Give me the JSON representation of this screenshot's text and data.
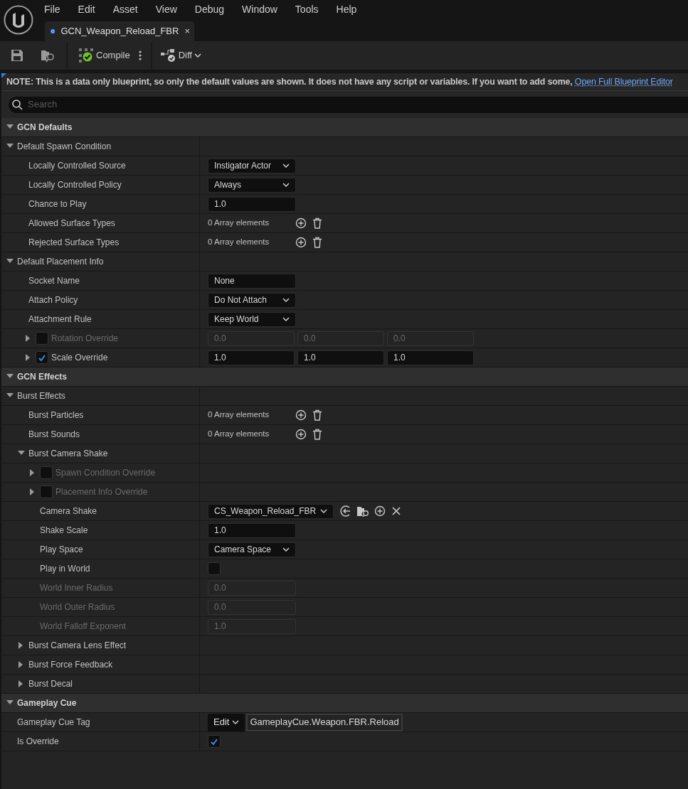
{
  "menu": [
    "File",
    "Edit",
    "Asset",
    "View",
    "Debug",
    "Window",
    "Tools",
    "Help"
  ],
  "tab": {
    "title": "GCN_Weapon_Reload_FBR",
    "close": "×"
  },
  "toolbar": {
    "compile": "Compile",
    "diff": "Diff"
  },
  "note": {
    "text": "NOTE: This is a data only blueprint, so only the default values are shown.  It does not have any script or variables.  If you want to add some,",
    "link": "Open Full Blueprint Editor"
  },
  "search": {
    "placeholder": "Search"
  },
  "categories": [
    {
      "label": "GCN Defaults",
      "expanded": true,
      "children": [
        {
          "kind": "group",
          "label": "Default Spawn Condition",
          "expanded": true,
          "children": [
            {
              "kind": "dropdown",
              "label": "Locally Controlled Source",
              "value": "Instigator Actor"
            },
            {
              "kind": "dropdown",
              "label": "Locally Controlled Policy",
              "value": "Always"
            },
            {
              "kind": "number",
              "label": "Chance to Play",
              "value": "1.0",
              "disabled": false
            },
            {
              "kind": "array",
              "label": "Allowed Surface Types",
              "value": "0 Array elements"
            },
            {
              "kind": "array",
              "label": "Rejected Surface Types",
              "value": "0 Array elements"
            }
          ]
        },
        {
          "kind": "group",
          "label": "Default Placement Info",
          "expanded": true,
          "children": [
            {
              "kind": "text",
              "label": "Socket Name",
              "value": "None"
            },
            {
              "kind": "dropdown",
              "label": "Attach Policy",
              "value": "Do Not Attach"
            },
            {
              "kind": "dropdown",
              "label": "Attachment Rule",
              "value": "Keep World"
            },
            {
              "kind": "vector",
              "label": "Rotation Override",
              "checked": false,
              "expanded": false,
              "values": [
                "0.0",
                "0.0",
                "0.0"
              ]
            },
            {
              "kind": "vector",
              "label": "Scale Override",
              "checked": true,
              "expanded": false,
              "values": [
                "1.0",
                "1.0",
                "1.0"
              ]
            }
          ]
        }
      ]
    },
    {
      "label": "GCN Effects",
      "expanded": true,
      "children": [
        {
          "kind": "group",
          "label": "Burst Effects",
          "expanded": true,
          "children": [
            {
              "kind": "array",
              "label": "Burst Particles",
              "value": "0 Array elements"
            },
            {
              "kind": "array",
              "label": "Burst Sounds",
              "value": "0 Array elements"
            },
            {
              "kind": "group",
              "label": "Burst Camera Shake",
              "expanded": true,
              "children": [
                {
                  "kind": "group",
                  "label": "Spawn Condition Override",
                  "checked": false,
                  "expanded": false
                },
                {
                  "kind": "group",
                  "label": "Placement Info Override",
                  "checked": false,
                  "expanded": false
                },
                {
                  "kind": "asset",
                  "label": "Camera Shake",
                  "value": "CS_Weapon_Reload_FBR"
                },
                {
                  "kind": "number",
                  "label": "Shake Scale",
                  "value": "1.0",
                  "disabled": false
                },
                {
                  "kind": "dropdown",
                  "label": "Play Space",
                  "value": "Camera Space"
                },
                {
                  "kind": "checkbox",
                  "label": "Play in World",
                  "checked": false
                },
                {
                  "kind": "number",
                  "label": "World Inner Radius",
                  "value": "0.0",
                  "disabled": true
                },
                {
                  "kind": "number",
                  "label": "World Outer Radius",
                  "value": "0.0",
                  "disabled": true
                },
                {
                  "kind": "number",
                  "label": "World Falloff Exponent",
                  "value": "1.0",
                  "disabled": true
                }
              ]
            },
            {
              "kind": "group",
              "label": "Burst Camera Lens Effect",
              "expanded": false
            },
            {
              "kind": "group",
              "label": "Burst Force Feedback",
              "expanded": false
            },
            {
              "kind": "group",
              "label": "Burst Decal",
              "expanded": false
            }
          ]
        }
      ]
    },
    {
      "label": "Gameplay Cue",
      "expanded": true,
      "children": [
        {
          "kind": "tag",
          "label": "Gameplay Cue Tag",
          "button": "Edit",
          "value": "GameplayCue.Weapon.FBR.Reload"
        },
        {
          "kind": "checkbox",
          "label": "Is Override",
          "checked": true
        }
      ]
    }
  ]
}
